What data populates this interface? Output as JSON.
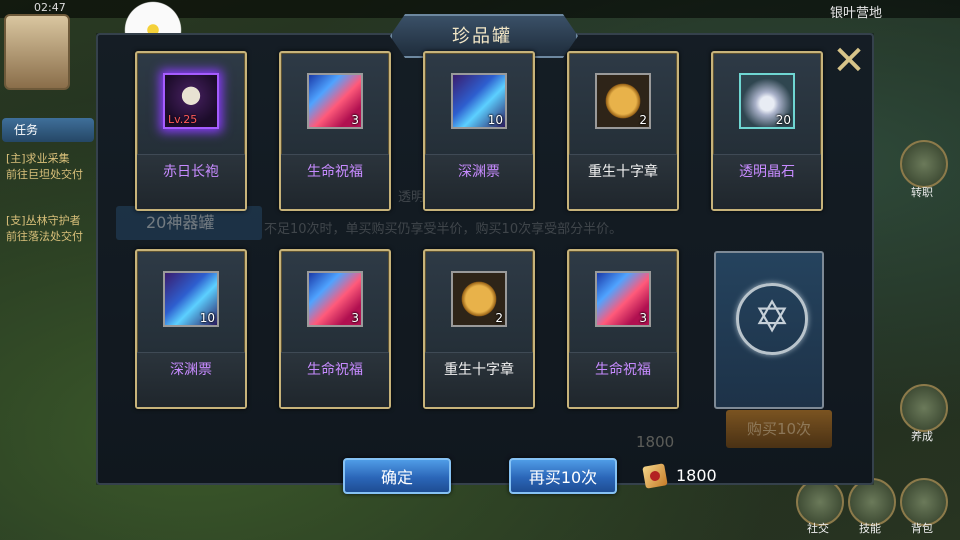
{
  "hud": {
    "time": "02:47",
    "map_name": "银叶营地"
  },
  "quest": {
    "tab_label": "任务",
    "lines": [
      "[主]求业采集",
      "前往巨坦处交付",
      "[支]丛林守护者",
      "前往落法处交付"
    ]
  },
  "right_menu": [
    "转职",
    "养成",
    "社交",
    "技能",
    "背包"
  ],
  "dialog": {
    "title": "珍品罐",
    "close_label": "✕",
    "behind": {
      "tab_label": "20神器罐",
      "info_line1": "透明",
      "info_line2": "不足10次时，单买购买仍享受半价，购买10次享受部分半价。",
      "buy_label": "购买10次",
      "price": "1800"
    },
    "items": [
      {
        "name": "赤日长袍",
        "level": "Lv.25",
        "count": "",
        "icon": "robe-icon",
        "rarity": "purple"
      },
      {
        "name": "生命祝福",
        "level": "",
        "count": "3",
        "icon": "blessing-icon",
        "rarity": "purple"
      },
      {
        "name": "深渊票",
        "level": "",
        "count": "10",
        "icon": "abyss-ticket-icon",
        "rarity": "purple"
      },
      {
        "name": "重生十字章",
        "level": "",
        "count": "2",
        "icon": "rebirth-cross-icon",
        "rarity": "white"
      },
      {
        "name": "透明晶石",
        "level": "",
        "count": "20",
        "icon": "crystal-icon",
        "rarity": "purple"
      },
      {
        "name": "深渊票",
        "level": "",
        "count": "10",
        "icon": "abyss-ticket-icon",
        "rarity": "purple"
      },
      {
        "name": "生命祝福",
        "level": "",
        "count": "3",
        "icon": "blessing-icon",
        "rarity": "purple"
      },
      {
        "name": "重生十字章",
        "level": "",
        "count": "2",
        "icon": "rebirth-cross-icon",
        "rarity": "white"
      },
      {
        "name": "生命祝福",
        "level": "",
        "count": "3",
        "icon": "blessing-icon",
        "rarity": "purple"
      }
    ],
    "confirm_label": "确定",
    "rebuy_label": "再买10次",
    "cost": "1800",
    "colors": {
      "purple_name": "#c78bff",
      "white_name": "#f1f1f1",
      "gold_frame": "#c7b37a",
      "button_blue": "#2b66b8"
    }
  }
}
